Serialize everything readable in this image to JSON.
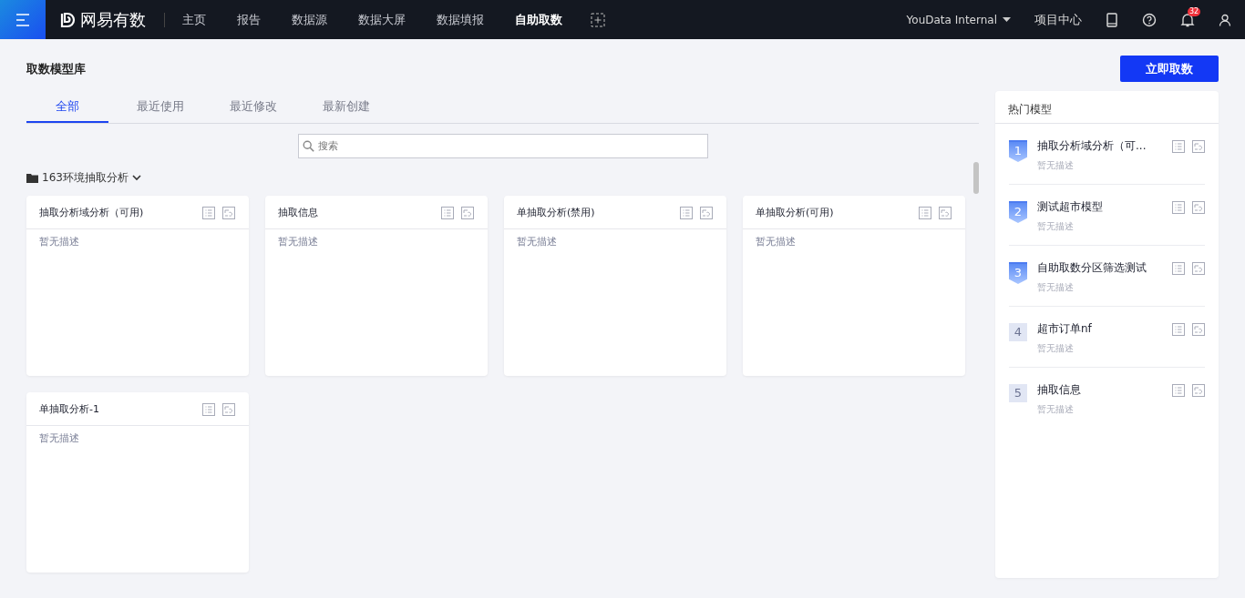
{
  "topbar": {
    "logo": "网易有数",
    "nav": [
      {
        "label": "主页",
        "selected": false
      },
      {
        "label": "报告",
        "selected": false
      },
      {
        "label": "数据源",
        "selected": false
      },
      {
        "label": "数据大屏",
        "selected": false
      },
      {
        "label": "数据填报",
        "selected": false
      },
      {
        "label": "自助取数",
        "selected": true
      }
    ],
    "workspace": "YouData Internal",
    "project_center": "项目中心",
    "notification_count": "32"
  },
  "page": {
    "title": "取数模型库",
    "primary_button": "立即取数"
  },
  "tabs": [
    {
      "label": "全部",
      "selected": true
    },
    {
      "label": "最近使用",
      "selected": false
    },
    {
      "label": "最近修改",
      "selected": false
    },
    {
      "label": "最新创建",
      "selected": false
    }
  ],
  "search": {
    "placeholder": "搜索"
  },
  "folder": {
    "name": "163环境抽取分析"
  },
  "models": [
    {
      "name": "抽取分析域分析（可用)",
      "description": "暂无描述"
    },
    {
      "name": "抽取信息",
      "description": "暂无描述"
    },
    {
      "name": "单抽取分析(禁用)",
      "description": "暂无描述"
    },
    {
      "name": "单抽取分析(可用)",
      "description": "暂无描述"
    },
    {
      "name": "单抽取分析-1",
      "description": "暂无描述"
    }
  ],
  "hot_models": {
    "title": "热门模型",
    "items": [
      {
        "rank": "1",
        "kind": "ribbon",
        "name": "抽取分析域分析（可...",
        "description": "暂无描述"
      },
      {
        "rank": "2",
        "kind": "ribbon",
        "name": "测试超市模型",
        "description": "暂无描述"
      },
      {
        "rank": "3",
        "kind": "ribbon",
        "name": "自助取数分区筛选测试",
        "description": "暂无描述"
      },
      {
        "rank": "4",
        "kind": "plain",
        "name": "超市订单nf",
        "description": "暂无描述"
      },
      {
        "rank": "5",
        "kind": "plain",
        "name": "抽取信息",
        "description": "暂无描述"
      }
    ]
  }
}
